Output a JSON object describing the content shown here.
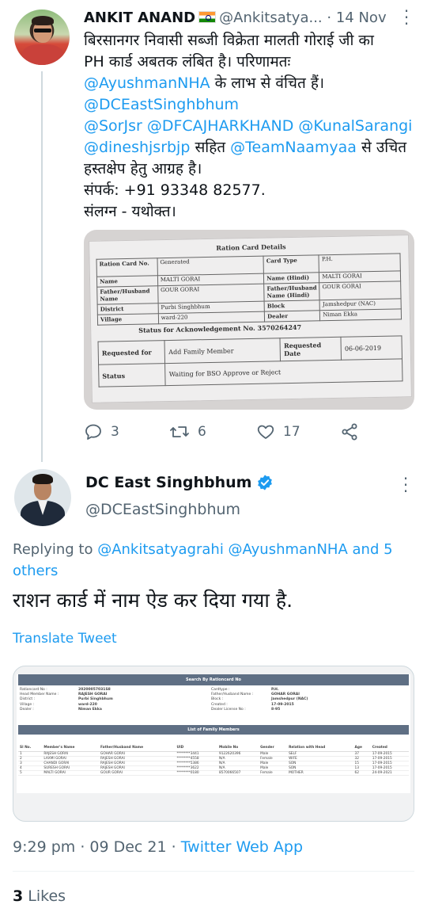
{
  "tweet1": {
    "name": "ANKIT ANAND",
    "handle": "@Ankitsatya...",
    "date": "· 14 Nov",
    "lines": [
      {
        "text": "बिरसानगर निवासी सब्जी विक्रेता मालती गोराई जी का",
        "kind": "plain"
      },
      {
        "text": "PH कार्ड अबतक लंबित है। परिणामतः",
        "kind": "plain"
      }
    ],
    "line3_link": "@AyushmanNHA",
    "line3_rest": " के लाभ से वंचित हैं।",
    "line4": "@DCEastSinghbhum",
    "line5": "@SorJsr @DFCAJHARKHAND @KunalSarangi",
    "line6_link1": "@dineshjsrbjp",
    "line6_mid": " सहित ",
    "line6_link2": "@TeamNaamyaa",
    "line6_rest": " से उचित",
    "line7": "हस्तक्षेप हेतु आग्रह है।",
    "line8": "संपर्क: +91 93348 82577.",
    "line9": "संलग्न - यथोक्त।",
    "ration_card": {
      "title": "Ration Card Details",
      "ration_card_no_label": "Ration Card No.",
      "ration_card_no_value": "Generated",
      "card_type_label": "Card Type",
      "card_type_value": "P.H.",
      "name_label": "Name",
      "name_value": "MALTI GORAI",
      "name_hindi_label": "Name (Hindi)",
      "name_hindi_value": "MALTI GORAI",
      "father_label": "Father/Husband Name",
      "father_value": "GOUR GORAI",
      "father_hindi_label": "Father/Husband Name (Hindi)",
      "father_hindi_value": "GOUR GORAI",
      "district_label": "District",
      "district_value": "Purbi Singhbhum",
      "block_label": "Block",
      "block_value": "Jamshedpur (NAC)",
      "village_label": "Village",
      "village_value": "ward-220",
      "dealer_label": "Dealer",
      "dealer_value": "Niman Ekka",
      "ack": "Status for Acknowledgement No. 3570264247",
      "requested_for_label": "Requested for",
      "requested_for_value": "Add Family Member",
      "requested_date_label": "Requested Date",
      "requested_date_value": "06-06-2019",
      "status_label": "Status",
      "status_value": "Waiting for BSO Approve or Reject"
    },
    "replies": "3",
    "retweets": "6",
    "likes": "17"
  },
  "tweet2": {
    "name": "DC East Singhbhum",
    "handle": "@DCEastSinghbhum",
    "replying_prefix": "Replying to ",
    "replying_links": "@Ankitsatyagrahi @AyushmanNHA",
    "replying_and": " and ",
    "replying_others": "5 others",
    "text": "राशन कार्ड में नाम ऐड कर दिया गया है.",
    "translate": "Translate Tweet",
    "screenshot": {
      "header": "Search By Rationcard No",
      "left_fields": [
        [
          "Rationcard No :",
          "20200057031S8"
        ],
        [
          "Head Member Name :",
          "RAJESH GORAI"
        ],
        [
          "District :",
          "Purbi Singhbhum"
        ],
        [
          "Village :",
          "ward-220"
        ],
        [
          "Dealer :",
          "Niman Ekka"
        ]
      ],
      "right_fields": [
        [
          "Cardtype :",
          "P.H."
        ],
        [
          "Father/Husband Name :",
          "GOHAR GORAI"
        ],
        [
          "Block :",
          "Jamshedpur (NAC)"
        ],
        [
          "Created :",
          "17-09-2015"
        ],
        [
          "Dealer License No :",
          "8-95"
        ]
      ],
      "family_header": "List of Family Members",
      "columns": [
        "Sl No.",
        "Member's Name",
        "Father/Husband Name",
        "UID",
        "Mobile No",
        "Gender",
        "Relation with Head",
        "Age",
        "Created"
      ],
      "rows": [
        [
          "1",
          "RAJESH GORAI",
          "GOHAR GORAI",
          "********3441",
          "9122620396",
          "Male",
          "SELF",
          "37",
          "17-09-2015"
        ],
        [
          "2",
          "LAXMI GORAI",
          "RAJESH GORAI",
          "********4558",
          "N/A",
          "Female",
          "WIFE",
          "32",
          "17-09-2015"
        ],
        [
          "3",
          "CHANDI GORAI",
          "RAJESH GORAI",
          "********5386",
          "N/A",
          "Male",
          "SON",
          "15",
          "17-09-2015"
        ],
        [
          "4",
          "SURESH GORAI",
          "RAJESH GORAI",
          "********3622",
          "N/A",
          "Male",
          "SON",
          "13",
          "17-09-2015"
        ],
        [
          "5",
          "MALTI GORAI",
          "GOUR GORAI",
          "********0180",
          "8570066507",
          "Female",
          "MOTHER",
          "62",
          "24-09-2021"
        ]
      ]
    },
    "timestamp": "9:29 pm · 09 Dec 21 · ",
    "source": "Twitter Web App",
    "likes_count": "3",
    "likes_label": "Likes"
  },
  "colors": {
    "link": "#1d9bf0",
    "muted": "#536471",
    "text": "#0f1419",
    "verified": "#1d9bf0"
  }
}
